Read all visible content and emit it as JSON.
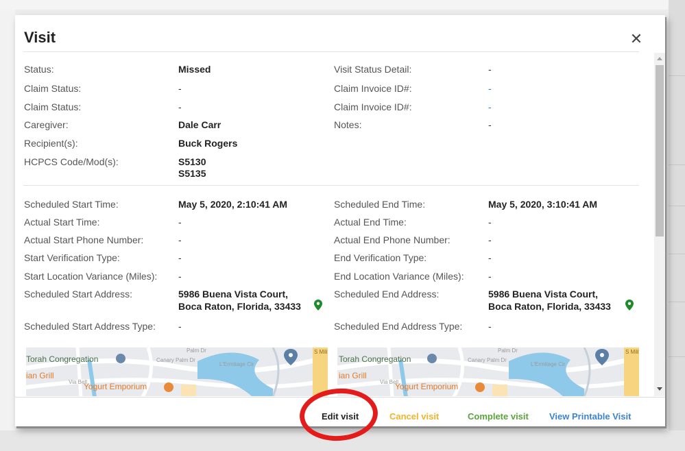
{
  "modal": {
    "title": "Visit",
    "close_glyph": "✕"
  },
  "summary": {
    "left": [
      {
        "label": "Status:",
        "value": "Missed"
      },
      {
        "label": "Claim Status:",
        "value": "-"
      },
      {
        "label": "Claim Status:",
        "value": "-"
      },
      {
        "label": "Caregiver:",
        "value": "Dale Carr"
      },
      {
        "label": "Recipient(s):",
        "value": "Buck Rogers"
      },
      {
        "label": "HCPCS Code/Mod(s):",
        "value": "S5130",
        "value2": "S5135"
      }
    ],
    "right": [
      {
        "label": "Visit Status Detail:",
        "value": "-"
      },
      {
        "label": "Claim Invoice ID#:",
        "value": "-"
      },
      {
        "label": "Claim Invoice ID#:",
        "value": "-"
      },
      {
        "label": "Notes:",
        "value": "-"
      }
    ]
  },
  "times": {
    "left": [
      {
        "label": "Scheduled Start Time:",
        "value": "May 5, 2020, 2:10:41 AM"
      },
      {
        "label": "Actual Start Time:",
        "value": "-"
      },
      {
        "label": "Actual Start Phone Number:",
        "value": "-"
      },
      {
        "label": "Start Verification Type:",
        "value": "-"
      },
      {
        "label": "Start Location Variance (Miles):",
        "value": "-"
      },
      {
        "label": "Scheduled Start Address:",
        "value": "5986 Buena Vista Court,",
        "value2": "Boca Raton, Florida, 33433"
      },
      {
        "label": "Scheduled Start Address Type:",
        "value": "-"
      }
    ],
    "right": [
      {
        "label": "Scheduled End Time:",
        "value": "May 5, 2020, 3:10:41 AM"
      },
      {
        "label": "Actual End Time:",
        "value": "-"
      },
      {
        "label": "Actual End Phone Number:",
        "value": "-"
      },
      {
        "label": "End Verification Type:",
        "value": "-"
      },
      {
        "label": "End Location Variance (Miles):",
        "value": "-"
      },
      {
        "label": "Scheduled End Address:",
        "value": "5986 Buena Vista Court,",
        "value2": "Boca Raton, Florida, 33433"
      },
      {
        "label": "Scheduled End Address Type:",
        "value": "-"
      }
    ]
  },
  "map": {
    "poi_congregation": "Torah Congregation",
    "poi_grill": "ian Grill",
    "poi_yogurt": "Yogurt Emporium",
    "street_palm": "Palm Dr",
    "street_canary": "Canary Palm Dr",
    "street_lermitage": "L'Ermitage Cir",
    "street_via": "Via Bell",
    "street_military": "S Military Tra"
  },
  "footer": {
    "edit": "Edit visit",
    "cancel": "Cancel visit",
    "complete": "Complete visit",
    "print": "View Printable Visit"
  },
  "colors": {
    "link": "#2b7bd6",
    "pin": "#1f8a2a",
    "cancel": "#f0b429",
    "complete": "#5aa33a",
    "print": "#3d83d0",
    "highlight": "#e31b1b"
  }
}
